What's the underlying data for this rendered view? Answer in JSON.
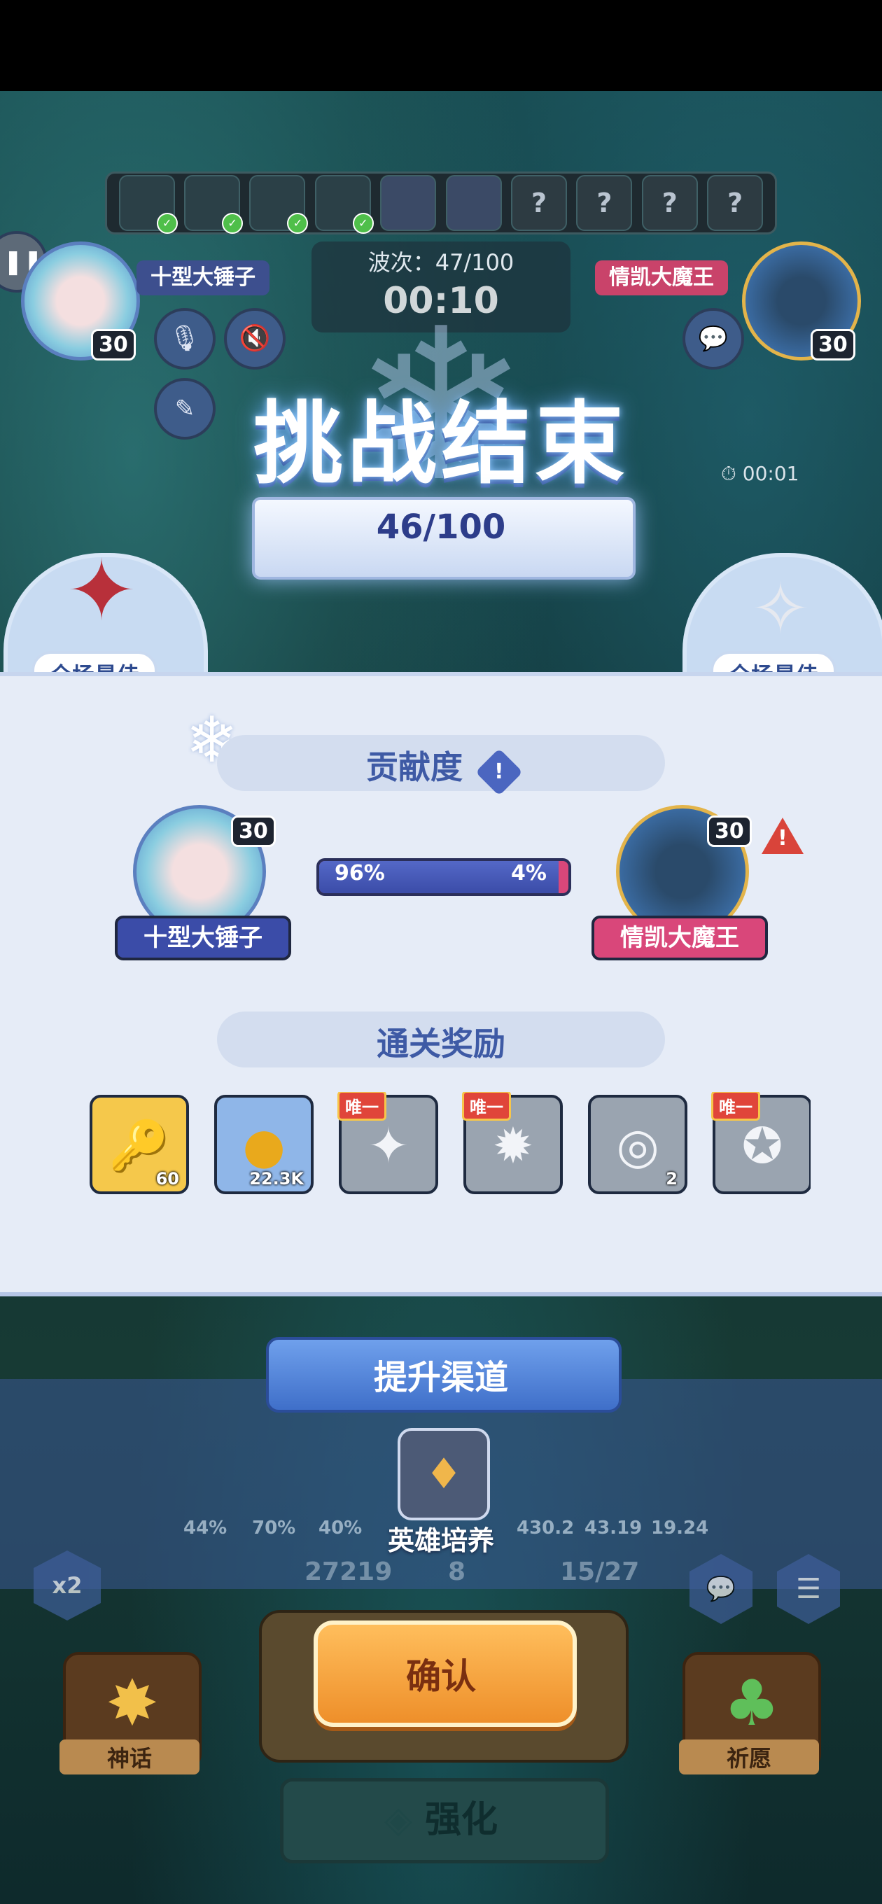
{
  "hud": {
    "wave_label": "波次：47/100",
    "timer": "00:10",
    "side_timer": "00:01",
    "player_left": {
      "name": "十型大锤子",
      "level": "30"
    },
    "player_right": {
      "name": "情凯大魔王",
      "level": "30"
    },
    "hero_strip": [
      {
        "state": "done"
      },
      {
        "state": "done"
      },
      {
        "state": "done"
      },
      {
        "state": "done"
      },
      {
        "state": "current"
      },
      {
        "state": "current"
      },
      {
        "state": "unknown",
        "mark": "?"
      },
      {
        "state": "unknown",
        "mark": "?"
      },
      {
        "state": "unknown",
        "mark": "?"
      },
      {
        "state": "unknown",
        "mark": "?"
      }
    ]
  },
  "result": {
    "title": "挑战结束",
    "score": "46/100",
    "mvp_left": "全场最佳",
    "mvp_right": "全场最佳",
    "contribution": {
      "title": "贡献度",
      "left_name": "十型大锤子",
      "left_level": "30",
      "right_name": "情凯大魔王",
      "right_level": "30",
      "left_pct": "96%",
      "right_pct": "4%",
      "left_fraction": 0.96
    },
    "rewards_title": "通关奖励",
    "rewards": [
      {
        "icon": "key-icon",
        "qty": "60",
        "bg": "#f5c84b",
        "unique": ""
      },
      {
        "icon": "gold-coin-icon",
        "qty": "22.3K",
        "bg": "#8fb6e8",
        "unique": ""
      },
      {
        "icon": "crystal-emblem-icon",
        "qty": "",
        "bg": "#9aa4b0",
        "unique": "唯一"
      },
      {
        "icon": "demon-emblem-icon",
        "qty": "",
        "bg": "#9aa4b0",
        "unique": "唯一"
      },
      {
        "icon": "silver-emblem-icon",
        "qty": "2",
        "bg": "#9aa4b0",
        "unique": ""
      },
      {
        "icon": "star-emblem-icon",
        "qty": "",
        "bg": "#9aa4b0",
        "unique": "唯一"
      }
    ]
  },
  "promote": {
    "title": "提升渠道",
    "hero_training": "英雄培养"
  },
  "background_stats": [
    "44%",
    "70%",
    "40%",
    "430.2",
    "43.19",
    "19.24"
  ],
  "background_counters": [
    "27219",
    "8",
    "15/27"
  ],
  "bottom": {
    "confirm": "确认",
    "upgrade": "强化",
    "myth": "神话",
    "wish": "祈愿",
    "multiplier": "x2"
  },
  "colors": {
    "panel": "#e6ecf7",
    "accent_blue": "#3e5aa5",
    "left_tag": "#3b4ca8",
    "right_tag": "#d9477a",
    "confirm": "#ee8f2a"
  }
}
